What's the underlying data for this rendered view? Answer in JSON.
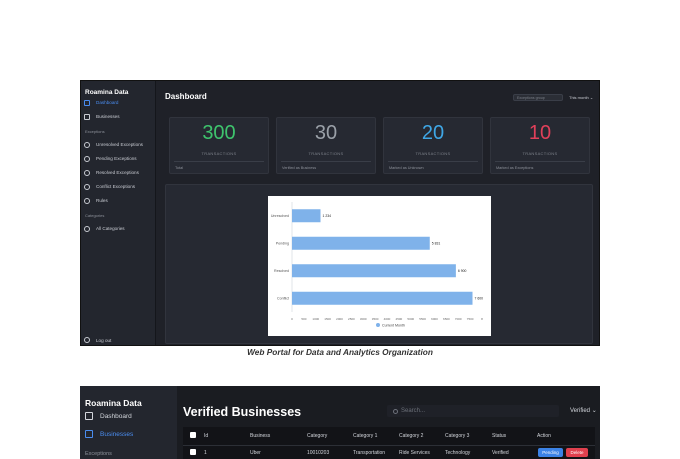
{
  "dashboard": {
    "brand": "Roamina Data",
    "title": "Dashboard",
    "search_placeholder": "Exceptions group",
    "period": "This month",
    "nav_main": [
      {
        "label": "Dashboard",
        "icon": "grid-icon",
        "active": true
      },
      {
        "label": "Businesses",
        "icon": "document-icon",
        "active": false
      }
    ],
    "section_exceptions": "Exceptions",
    "nav_exceptions": [
      {
        "label": "Unresolved Exceptions",
        "icon": "circle-icon"
      },
      {
        "label": "Pending Exceptions",
        "icon": "circle-icon"
      },
      {
        "label": "Resolved Exceptions",
        "icon": "circle-icon"
      },
      {
        "label": "Conflict Exceptions",
        "icon": "circle-icon"
      },
      {
        "label": "Rules",
        "icon": "circle-icon"
      }
    ],
    "section_categories": "Categories",
    "nav_categories": [
      {
        "label": "All Categories",
        "icon": "circle-icon"
      }
    ],
    "logout": "Log out",
    "cards": [
      {
        "value": "300",
        "label": "TRANSACTIONS",
        "footer": "Total",
        "color": "#3ec46d"
      },
      {
        "value": "30",
        "label": "TRANSACTIONS",
        "footer": "Verified as Business",
        "color": "#9aa0a8"
      },
      {
        "value": "20",
        "label": "TRANSACTIONS",
        "footer": "Marked as Unknown",
        "color": "#3fa7e6"
      },
      {
        "value": "10",
        "label": "TRANSACTIONS",
        "footer": "Marked as Exceptions",
        "color": "#e0405a"
      }
    ]
  },
  "chart_data": {
    "type": "bar",
    "orientation": "horizontal",
    "categories": [
      "Unresolved",
      "Pending",
      "Resolved",
      "Conflict"
    ],
    "series": [
      {
        "name": "Current Month",
        "values": [
          1.2,
          5.8,
          6.9,
          7.6
        ],
        "labels": [
          "1 234",
          "5 831",
          "6 900",
          "7 600"
        ],
        "color": "#7fb2ea"
      }
    ],
    "xlim": [
      0,
      8
    ],
    "xticks": [
      "0",
      "500",
      "1000",
      "1500",
      "2000",
      "2500",
      "3000",
      "3500",
      "4000",
      "4500",
      "5000",
      "5500",
      "6000",
      "6500",
      "7000",
      "7500",
      "8"
    ],
    "legend_position": "bottom",
    "grid": false,
    "title": "",
    "xlabel": "",
    "ylabel": ""
  },
  "caption": "Web Portal for Data and Analytics Organization",
  "businesses": {
    "brand": "Roamina Data",
    "title": "Verified Businesses",
    "search_placeholder": "Search...",
    "filter": "Verified",
    "nav": [
      {
        "label": "Dashboard",
        "icon": "grid-icon",
        "active": false
      },
      {
        "label": "Businesses",
        "icon": "document-icon",
        "active": true
      }
    ],
    "section_exceptions": "Exceptions",
    "columns": [
      "Id",
      "Business",
      "Category",
      "Category 1",
      "Category 2",
      "Category 3",
      "Status",
      "Action"
    ],
    "rows": [
      {
        "id": "1",
        "business": "Uber",
        "category": "10010203",
        "category1": "Transportation",
        "category2": "Ride Services",
        "category3": "Technology",
        "status": "Verified"
      }
    ],
    "actions": {
      "pending": "Pending",
      "delete": "Delete"
    },
    "pending_color": "#3b82e6",
    "delete_color": "#e0404e"
  }
}
